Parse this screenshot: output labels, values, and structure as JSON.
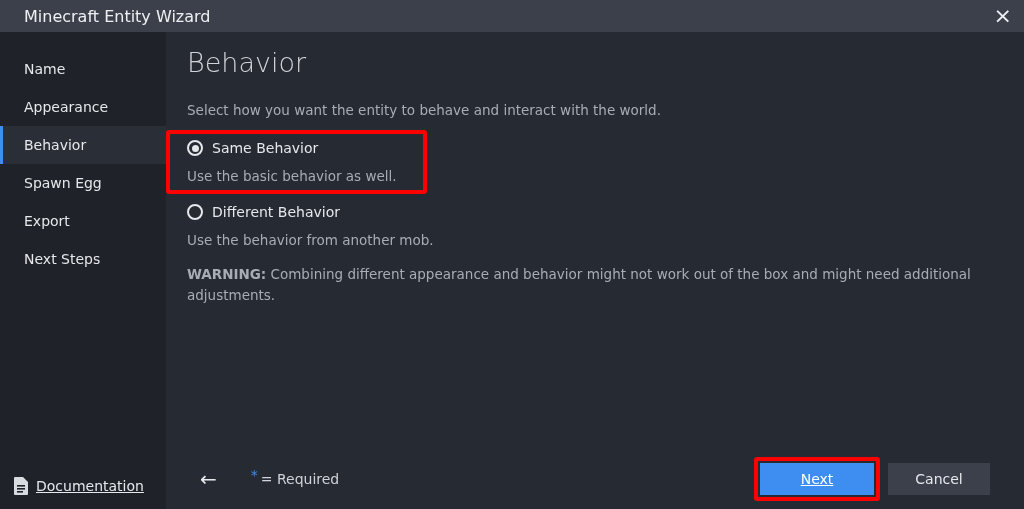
{
  "window": {
    "title": "Minecraft Entity Wizard",
    "close": "×"
  },
  "sidebar": {
    "items": [
      {
        "label": "Name",
        "selected": false
      },
      {
        "label": "Appearance",
        "selected": false
      },
      {
        "label": "Behavior",
        "selected": true
      },
      {
        "label": "Spawn Egg",
        "selected": false
      },
      {
        "label": "Export",
        "selected": false
      },
      {
        "label": "Next Steps",
        "selected": false
      }
    ],
    "documentation_link": "Documentation"
  },
  "page": {
    "heading": "Behavior",
    "intro": "Select how you want the entity to behave and interact with the world.",
    "options": [
      {
        "label": "Same Behavior",
        "description": "Use the basic behavior as well.",
        "selected": true,
        "highlighted": true
      },
      {
        "label": "Different Behavior",
        "description": "Use the behavior from another mob.",
        "selected": false,
        "highlighted": false
      }
    ],
    "warning": "**WARNING:** Combining different appearance and behavior might not work out of the box and might need additional adjustments."
  },
  "footer": {
    "back": "←",
    "required_mark": "*",
    "required_text": "= Required",
    "buttons": [
      {
        "label": "Next",
        "kind": "primary",
        "highlighted": true
      },
      {
        "label": "Cancel",
        "kind": "secondary",
        "highlighted": false
      }
    ]
  }
}
